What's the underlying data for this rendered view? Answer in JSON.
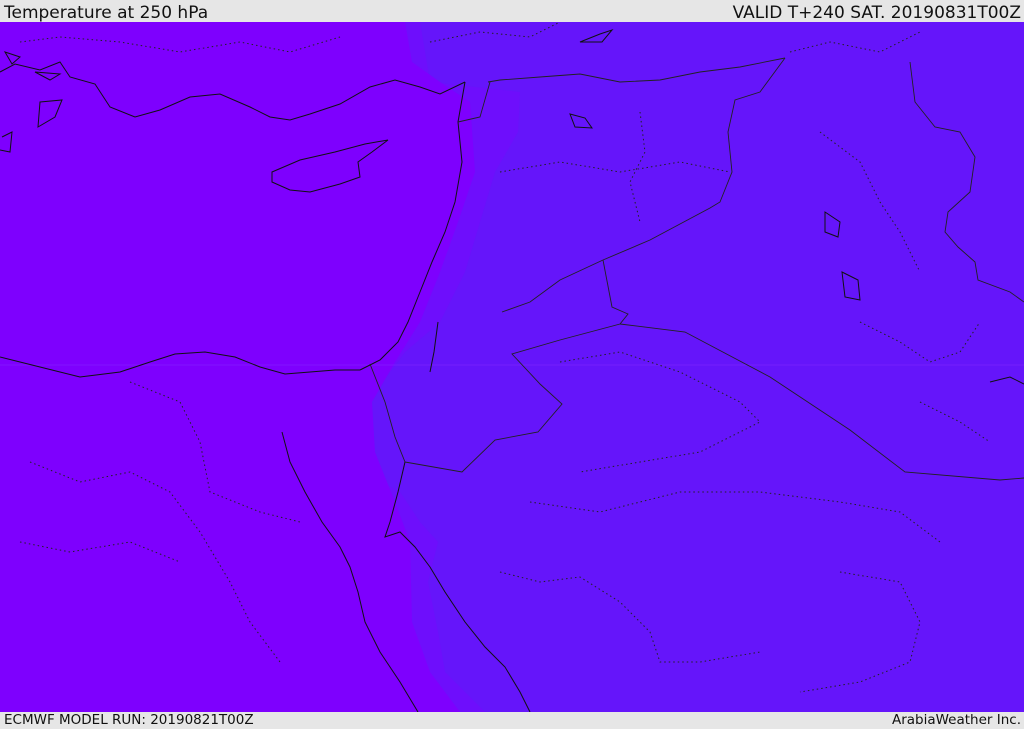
{
  "header": {
    "title": "Temperature at 250 hPa",
    "valid": "VALID T+240 SAT. 20190831T00Z"
  },
  "footer": {
    "model_run": "ECMWF MODEL RUN: 20190821T00Z",
    "credit": "ArabiaWeather Inc."
  },
  "map": {
    "field": "temperature",
    "level": "250 hPa",
    "colors": {
      "west_band": "#7e00fe",
      "transition_band": "#6e0efc",
      "east_band": "#6515fa",
      "coastline": "#111111",
      "borders": "#222222"
    }
  }
}
